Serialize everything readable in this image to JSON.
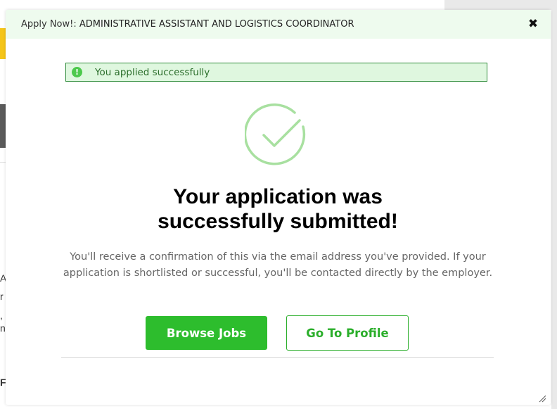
{
  "background": {
    "chars": [
      "A",
      "r",
      ",",
      "n",
      "F"
    ]
  },
  "modal": {
    "title_prefix": "Apply Now!: ",
    "title_job": "ADMINISTRATIVE ASSISTANT AND LOGISTICS COORDINATOR",
    "close_glyph": "✖"
  },
  "alert": {
    "text": "You applied successfully",
    "icon": "exclamation-circle-icon",
    "color": "#2e8b3a"
  },
  "success": {
    "icon": "checkmark-circle-icon",
    "headline_line1": "Your application was",
    "headline_line2": "successfully submitted!",
    "description": "You'll receive a confirmation of this via the email address you've provided. If your application is shortlisted or successful, you'll be contacted directly by the employer."
  },
  "actions": {
    "browse_label": "Browse Jobs",
    "profile_label": "Go To Profile",
    "accent": "#2dbd2d"
  }
}
